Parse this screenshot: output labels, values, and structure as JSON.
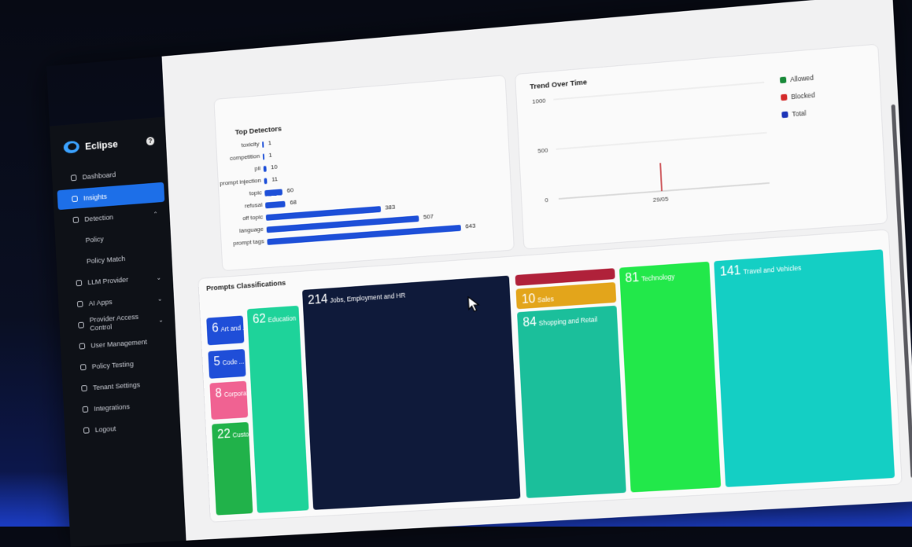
{
  "brand": {
    "name": "Eclipse"
  },
  "nav": [
    {
      "label": "Dashboard",
      "icon": "dashboard-icon"
    },
    {
      "label": "Insights",
      "icon": "chart-icon",
      "active": true
    },
    {
      "label": "Detection",
      "icon": "edit-icon",
      "chevron": "⌃"
    },
    {
      "label": "Policy",
      "sub": true
    },
    {
      "label": "Policy Match",
      "sub": true
    },
    {
      "label": "LLM Provider",
      "icon": "box-icon",
      "chevron": "⌄"
    },
    {
      "label": "AI Apps",
      "icon": "grid-icon",
      "chevron": "⌄"
    },
    {
      "label": "Provider Access Control",
      "icon": "user-icon",
      "chevron": "⌄"
    },
    {
      "label": "User Management",
      "icon": "users-icon"
    },
    {
      "label": "Policy Testing",
      "icon": "check-circle-icon"
    },
    {
      "label": "Tenant Settings",
      "icon": "settings-icon"
    },
    {
      "label": "Integrations",
      "icon": "plug-icon"
    },
    {
      "label": "Logout",
      "icon": "logout-icon"
    }
  ],
  "top_detectors": {
    "title": "Top Detectors",
    "rows": [
      {
        "label": "toxicity",
        "value": 1
      },
      {
        "label": "competition",
        "value": 1
      },
      {
        "label": "pii",
        "value": 10
      },
      {
        "label": "prompt injection",
        "value": 11
      },
      {
        "label": "topic",
        "value": 60
      },
      {
        "label": "refusal",
        "value": 68
      },
      {
        "label": "off topic",
        "value": 383
      },
      {
        "label": "language",
        "value": 507
      },
      {
        "label": "prompt tags",
        "value": 643
      }
    ],
    "max": 643
  },
  "trend": {
    "title": "Trend Over Time",
    "y_ticks": [
      "1000",
      "500",
      "0"
    ],
    "x_tick": "29/05",
    "legend": [
      {
        "label": "Allowed",
        "color": "#1a8a3a"
      },
      {
        "label": "Blocked",
        "color": "#d42a2a"
      },
      {
        "label": "Total",
        "color": "#1d35b8"
      }
    ]
  },
  "classifications": {
    "title": "Prompts Classifications",
    "tiles": [
      {
        "num": "6",
        "label": "Art and ...",
        "color": "#1f4ed8"
      },
      {
        "num": "5",
        "label": "Code ...",
        "color": "#1f4ed8"
      },
      {
        "num": "8",
        "label": "Corporat...",
        "color": "#f06292"
      },
      {
        "num": "22",
        "label": "Custo...",
        "color": "#21b24a"
      },
      {
        "num": "62",
        "label": "Education",
        "color": "#1ed39a"
      },
      {
        "num": "214",
        "label": "Jobs, Employment and HR",
        "color": "#0f1a3a"
      },
      {
        "num": "",
        "label": "",
        "color": "#b0213a"
      },
      {
        "num": "10",
        "label": "Sales",
        "color": "#e3a51b"
      },
      {
        "num": "84",
        "label": "Shopping and Retail",
        "color": "#1bbf9b"
      },
      {
        "num": "81",
        "label": "Technology",
        "color": "#22e84a"
      },
      {
        "num": "141",
        "label": "Travel and Vehicles",
        "color": "#14cfc4"
      }
    ]
  }
}
